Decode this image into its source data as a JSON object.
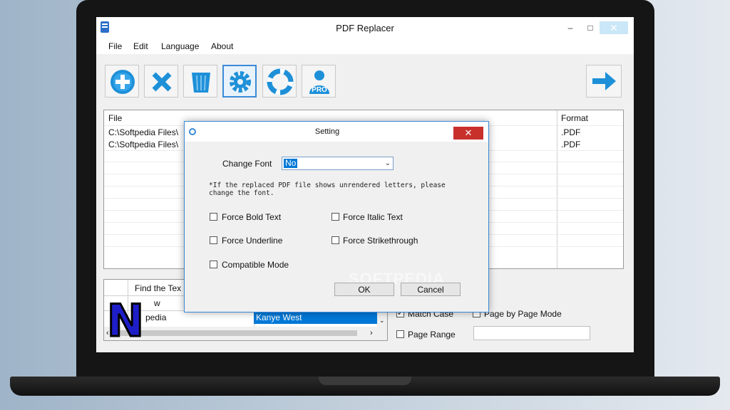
{
  "app": {
    "title": "PDF Replacer",
    "window_controls": {
      "minimize": "–",
      "maximize": "□",
      "close": "✕"
    }
  },
  "menu": [
    "File",
    "Edit",
    "Language",
    "About"
  ],
  "toolbar": {
    "buttons": [
      {
        "icon": "add-icon"
      },
      {
        "icon": "delete-icon"
      },
      {
        "icon": "trash-icon"
      },
      {
        "icon": "settings-icon",
        "active": true
      },
      {
        "icon": "help-icon"
      },
      {
        "icon": "pro-user-icon",
        "text": "PRO"
      }
    ],
    "next": {
      "icon": "arrow-right-icon"
    }
  },
  "file_list": {
    "headers": {
      "file": "File",
      "format": "Format"
    },
    "rows": [
      {
        "file": "C:\\Softpedia Files\\",
        "format": ".PDF"
      },
      {
        "file": "C:\\Softpedia Files\\",
        "format": ".PDF"
      }
    ]
  },
  "replace_table": {
    "header": "Find the Tex",
    "rows": [
      {
        "find": "w",
        "replace": ""
      },
      {
        "find": "pedia",
        "replace": "Kanye West"
      }
    ]
  },
  "options": {
    "match_case": "Match Case",
    "match_case_checked": true,
    "page_by_page": "Page by Page Mode",
    "page_range": "Page Range"
  },
  "overlay_logo": "N",
  "watermark": "SOFTPEDIA",
  "dialog": {
    "title": "Setting",
    "close": "✕",
    "change_font_label": "Change Font",
    "change_font_value": "No",
    "note": "*If the replaced PDF file shows unrendered letters, please change the font.",
    "checkboxes": {
      "bold": "Force Bold Text",
      "italic": "Force Italic Text",
      "underline": "Force Underline",
      "strike": "Force Strikethrough",
      "compatible": "Compatible Mode"
    },
    "ok": "OK",
    "cancel": "Cancel"
  },
  "colors": {
    "accent": "#3a8ad8",
    "selection": "#0078d7",
    "close_red": "#c8302c",
    "icon_blue": "#1e90d8"
  }
}
